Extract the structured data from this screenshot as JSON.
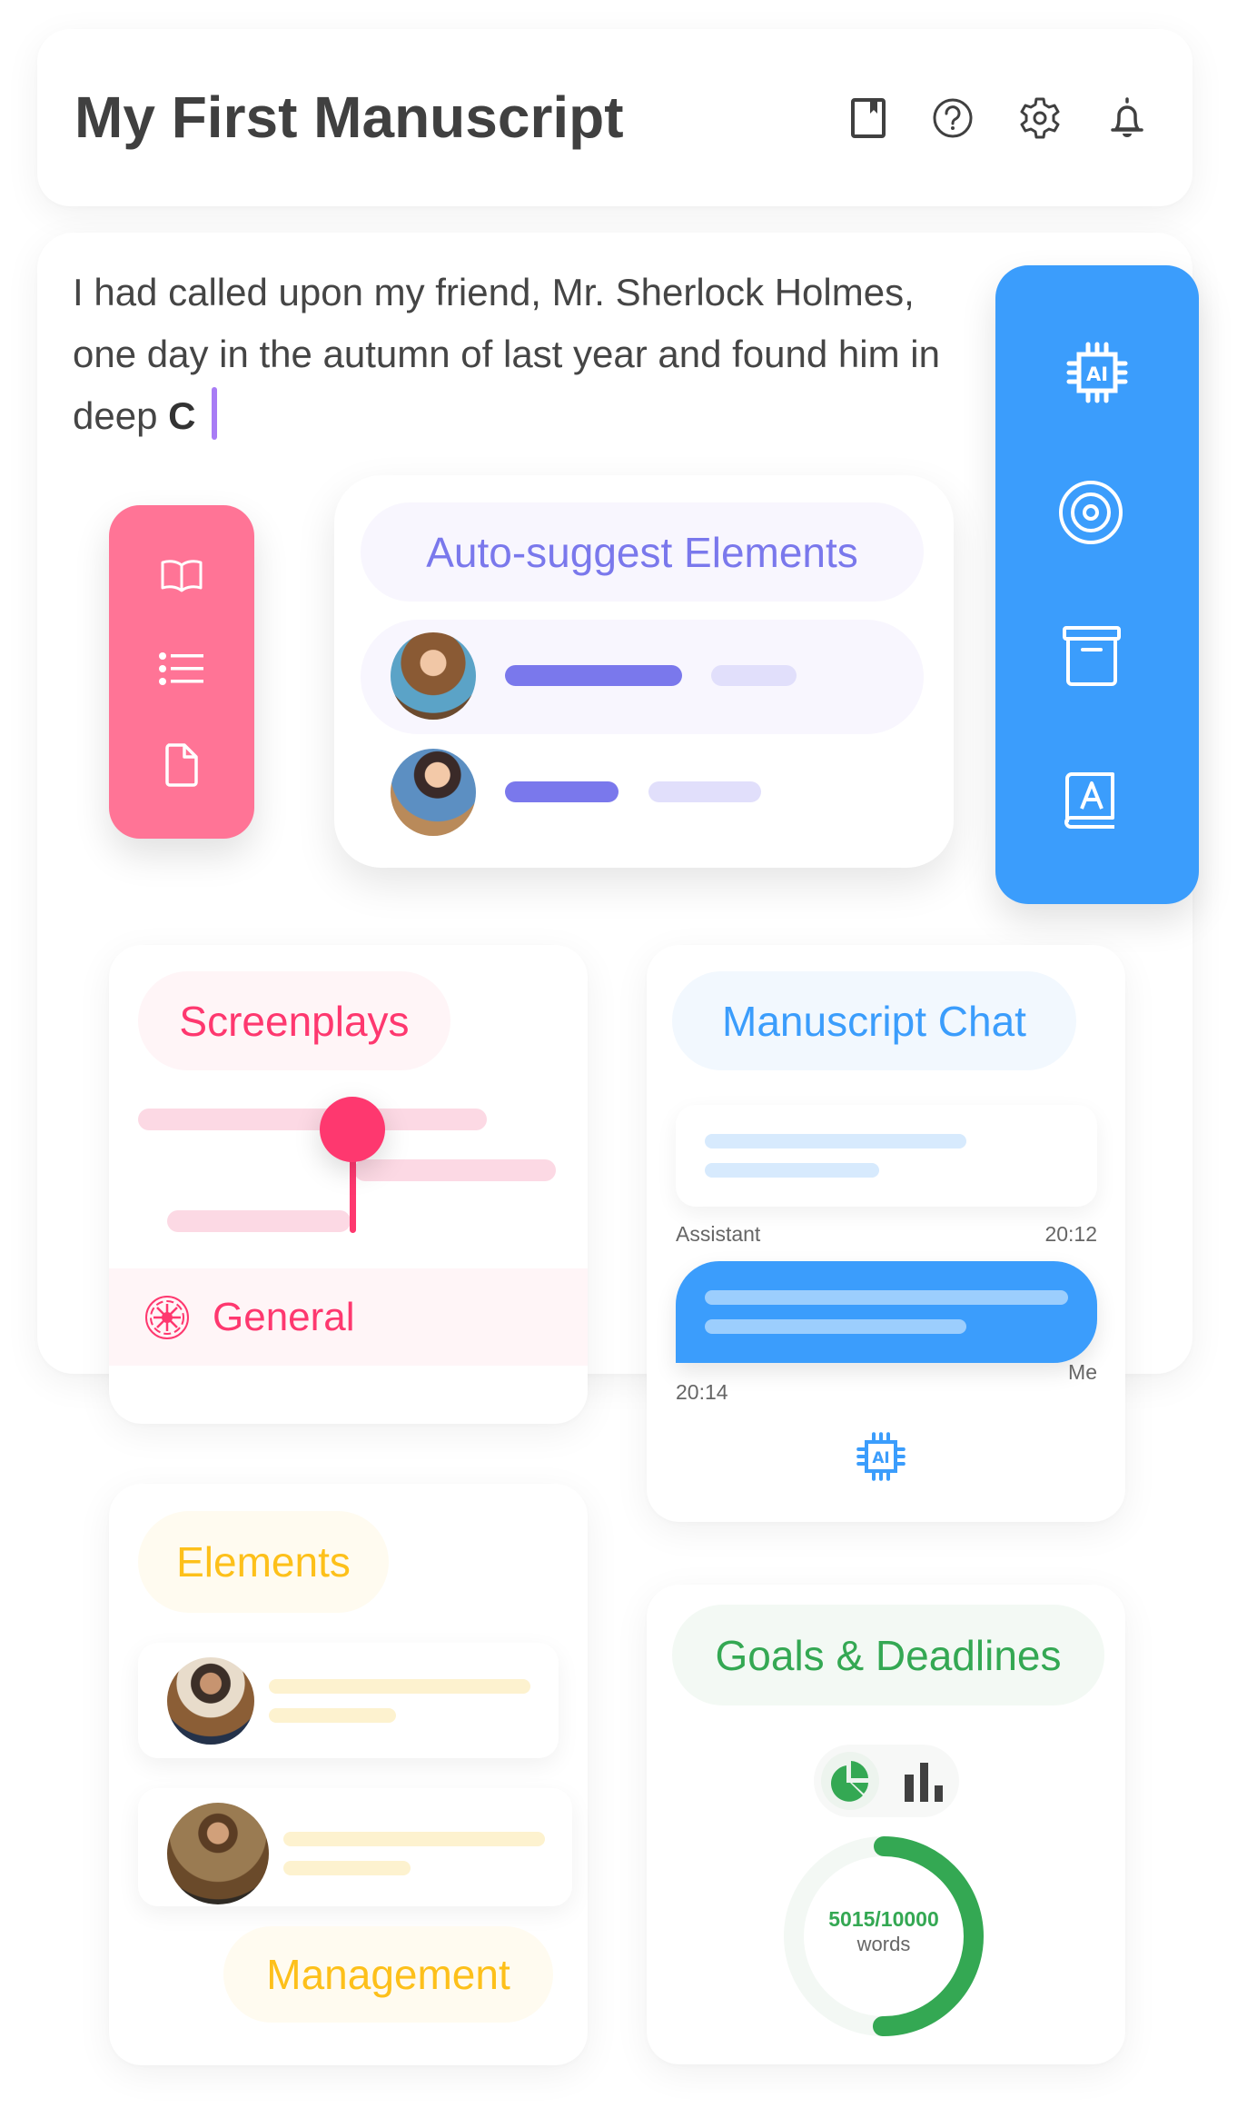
{
  "header": {
    "title": "My First Manuscript",
    "icons": [
      "bookmark-icon",
      "help-icon",
      "settings-icon",
      "notification-icon"
    ]
  },
  "editor": {
    "text_before": "I had called upon my friend, Mr. Sherlock Holmes, one day in the autumn of last year and found him in deep ",
    "text_bold": "C",
    "caret_color": "#a87cf5"
  },
  "left_toolbar": {
    "color": "#ff7496",
    "icons": [
      "book-open-icon",
      "list-icon",
      "file-icon"
    ]
  },
  "right_toolbar": {
    "color": "#3b9dfc",
    "icons": [
      "ai-chip-icon",
      "target-icon",
      "archive-icon",
      "dictionary-icon"
    ]
  },
  "auto_suggest": {
    "title": "Auto-suggest Elements",
    "color": "#7a78ec",
    "items": [
      {
        "avatar": "detective-woman-avatar",
        "highlighted": true
      },
      {
        "avatar": "glamour-woman-avatar",
        "highlighted": false
      }
    ]
  },
  "screenplays": {
    "title": "Screenplays",
    "color": "#fe386f",
    "category": "General"
  },
  "chat": {
    "title": "Manuscript Chat",
    "color": "#3b9dfc",
    "messages": [
      {
        "sender": "Assistant",
        "time": "20:12"
      },
      {
        "sender": "Me",
        "time": "20:14"
      }
    ]
  },
  "elements": {
    "title": "Elements",
    "subtitle": "Management",
    "color": "#fdc01a",
    "items": [
      {
        "avatar": "king-avatar"
      },
      {
        "avatar": "queen-avatar"
      }
    ]
  },
  "goals": {
    "title": "Goals & Deadlines",
    "color": "#34a853",
    "view_toggle": {
      "active": "pie",
      "options": [
        "pie",
        "bar"
      ]
    },
    "progress": {
      "current": 5015,
      "target": 10000,
      "label": "5015/10000",
      "unit": "words",
      "fraction": 0.5015
    }
  }
}
